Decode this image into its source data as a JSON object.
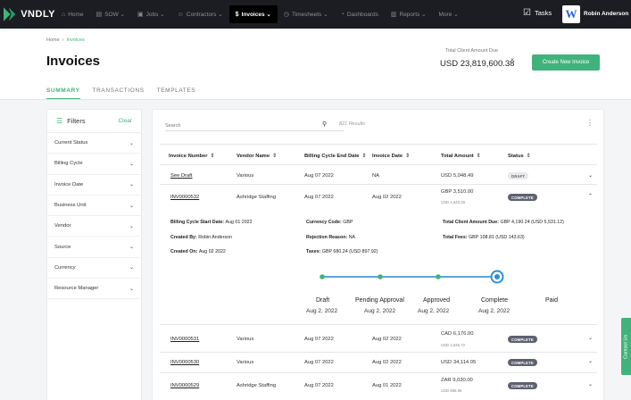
{
  "brand": {
    "name": "VNDLY",
    "mark_color": "#3fb37b"
  },
  "nav": {
    "items": [
      {
        "label": "Home",
        "icon": "home-icon"
      },
      {
        "label": "SOW",
        "icon": "sow-icon"
      },
      {
        "label": "Jobs",
        "icon": "jobs-icon"
      },
      {
        "label": "Contractors",
        "icon": "contractors-icon"
      },
      {
        "label": "Invoices",
        "icon": "dollar-icon",
        "active": true
      },
      {
        "label": "Timesheets",
        "icon": "clock-icon"
      },
      {
        "label": "Dashboards",
        "icon": "dashboard-icon"
      },
      {
        "label": "Reports",
        "icon": "report-icon"
      },
      {
        "label": "More",
        "icon": ""
      }
    ],
    "tasks_label": "Tasks",
    "user_name": "Robin Anderson"
  },
  "breadcrumb": {
    "home": "Home",
    "current": "Invoices"
  },
  "page": {
    "title": "Invoices",
    "tabs": [
      "SUMMARY",
      "TRANSACTIONS",
      "TEMPLATES"
    ],
    "active_tab": 0,
    "total_label": "Total Client Amount Due",
    "total_value": "USD 23,819,600.38",
    "create_button": "Create New Invoice"
  },
  "filters": {
    "title": "Filters",
    "clear": "Clear",
    "items": [
      "Current Status",
      "Billing Cycle",
      "Invoice Date",
      "Business Unit",
      "Vendor",
      "Source",
      "Currency",
      "Resource Manager"
    ]
  },
  "search": {
    "placeholder": "Search",
    "results": "821 Results"
  },
  "table": {
    "headers": [
      "Invoice Number",
      "Vendor Name",
      "Billing Cycle End Date",
      "Invoice Date",
      "Total Amount",
      "Status"
    ],
    "rows": [
      {
        "invoice": "See Draft",
        "vendor": "Various",
        "cycle_end": "Aug 07 2022",
        "invoice_date": "NA",
        "amount": "USD 5,048.49",
        "amount_sub": "",
        "status": "DRAFT"
      },
      {
        "invoice": "INV0000532",
        "vendor": "Ashridge Staffing",
        "cycle_end": "Aug 07 2022",
        "invoice_date": "Aug 02 2022",
        "amount": "GBP 3,510.00",
        "amount_sub": "USD 4,623.28",
        "status": "COMPLETE"
      },
      {
        "invoice": "INV0000531",
        "vendor": "Various",
        "cycle_end": "Aug 07 2022",
        "invoice_date": "Aug 02 2022",
        "amount": "CAD 6,176.00",
        "amount_sub": "USD 4,846.72",
        "status": "COMPLETE"
      },
      {
        "invoice": "INV0000530",
        "vendor": "Various",
        "cycle_end": "Aug 07 2022",
        "invoice_date": "Aug 02 2022",
        "amount": "USD 34,114.05",
        "amount_sub": "",
        "status": "COMPLETE"
      },
      {
        "invoice": "INV0000529",
        "vendor": "Ashridge Staffing",
        "cycle_end": "Aug 07 2022",
        "invoice_date": "Aug 01 2022",
        "amount": "ZAR 9,030.00",
        "amount_sub": "USD 556.95",
        "status": "COMPLETE"
      }
    ]
  },
  "details": {
    "billing_start_label": "Billing Cycle Start Date:",
    "billing_start": "Aug 01 2022",
    "currency_label": "Currency Code:",
    "currency": "GBP",
    "total_due_label": "Total Client Amount Due:",
    "total_due": "GBP 4,190.24 (USD 5,531.12)",
    "created_by_label": "Created By:",
    "created_by": "Robin Anderson",
    "rejection_label": "Rejection Reason:",
    "rejection": "NA",
    "fees_label": "Total Fees:",
    "fees": "GBP 108.81 (USD 143.63)",
    "created_on_label": "Created On:",
    "created_on": "Aug 02 2022",
    "taxes_label": "Taxes:",
    "taxes": "GBP 680.24 (USD 897.92)"
  },
  "progress": {
    "steps": [
      {
        "label": "Draft",
        "date": "Aug 2, 2022"
      },
      {
        "label": "Pending Approval",
        "date": "Aug 2, 2022"
      },
      {
        "label": "Approved",
        "date": "Aug 2, 2022"
      },
      {
        "label": "Complete",
        "date": "Aug 2, 2022"
      },
      {
        "label": "Paid",
        "date": ""
      }
    ],
    "current_step": 3
  },
  "contact_us": "Contact Us",
  "colors": {
    "accent": "#3fb37b",
    "progress": "#2d8fd6",
    "nav_bg": "#1c1d22"
  }
}
